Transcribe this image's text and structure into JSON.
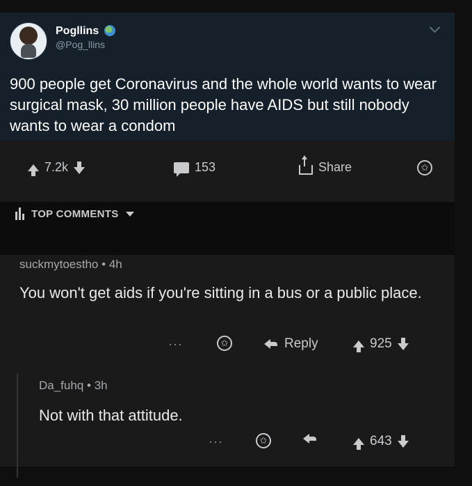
{
  "tweet": {
    "name": "Pogllins",
    "handle": "@Pog_llins",
    "text": "900 people get Coronavirus and the whole world wants to wear surgical mask, 30 million people have AIDS but still nobody wants to wear a condom"
  },
  "post_actions": {
    "votes": "7.2k",
    "comments": "153",
    "share_label": "Share"
  },
  "top_comments_label": "TOP COMMENTS",
  "comments": [
    {
      "author": "suckmytoestho",
      "age": "4h",
      "text": "You won't get aids if you're sitting in a bus or a public place.",
      "reply_label": "Reply",
      "votes": "925"
    },
    {
      "author": "Da_fuhq",
      "age": "3h",
      "text": "Not with that attitude.",
      "votes": "643"
    }
  ],
  "icons": {
    "more": "···",
    "award": "✩"
  }
}
